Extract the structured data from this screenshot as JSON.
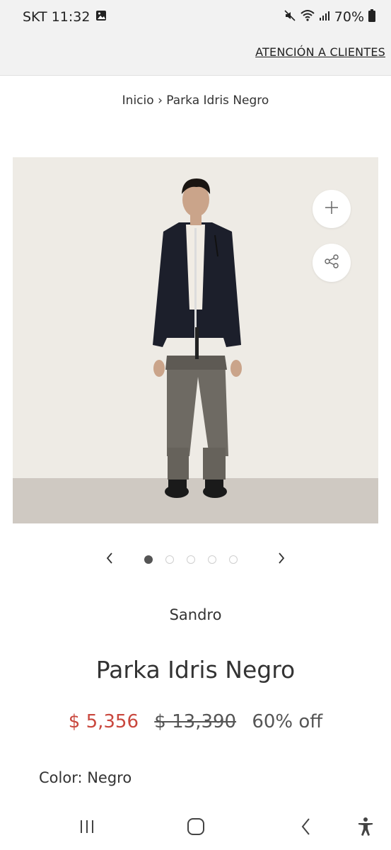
{
  "status_bar": {
    "carrier_time": "SKT 11:32",
    "battery": "70%",
    "icons": [
      "gallery-icon",
      "mute-icon",
      "wifi-icon",
      "signal-icon",
      "battery-icon"
    ]
  },
  "header": {
    "customer_service": "ATENCIÓN A CLIENTES"
  },
  "breadcrumb": {
    "home": "Inicio",
    "separator": "›",
    "current": "Parka Idris Negro"
  },
  "gallery": {
    "image_count": 5,
    "active_index": 0,
    "buttons": [
      "plus-icon",
      "share-icon"
    ]
  },
  "product": {
    "brand": "Sandro",
    "title": "Parka Idris Negro",
    "sale_price": "$ 5,356",
    "original_price": "$ 13,390",
    "discount": "60% off",
    "color_label": "Color: Negro"
  },
  "colors": {
    "sale": "#c9473d",
    "background": "#eeebe5"
  },
  "system_nav": [
    "recents-icon",
    "home-icon",
    "back-icon",
    "accessibility-icon"
  ]
}
